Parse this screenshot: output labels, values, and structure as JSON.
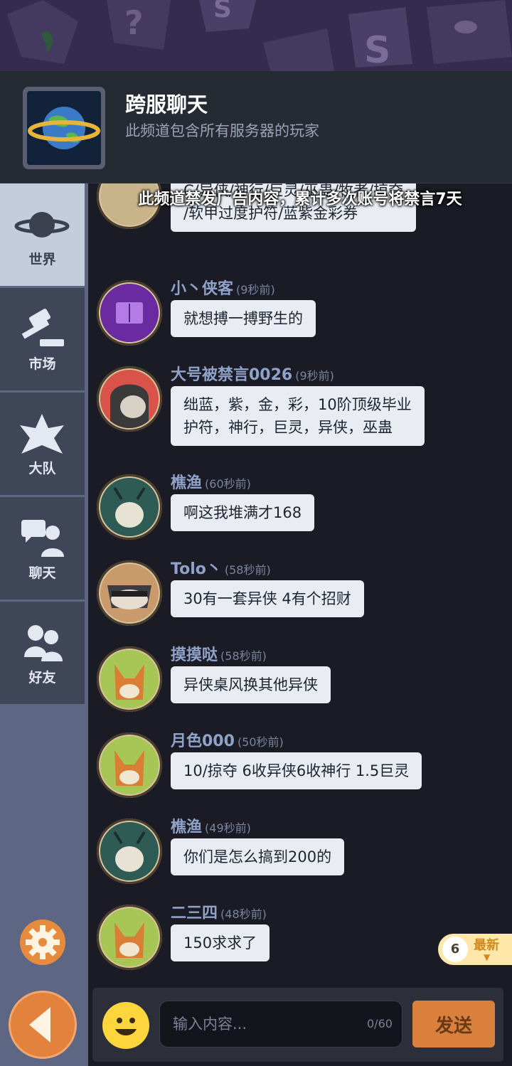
{
  "channel": {
    "title": "跨服聊天",
    "subtitle": "此频道包含所有服务器的玩家",
    "rules_notice": "此频道禁发广告内容，累计多次账号将禁言7天"
  },
  "sidebar": {
    "items": [
      {
        "label": "世界",
        "icon": "planet-icon",
        "active": true
      },
      {
        "label": "市场",
        "icon": "gavel-icon",
        "active": false
      },
      {
        "label": "大队",
        "icon": "guild-crest-icon",
        "active": false
      },
      {
        "label": "聊天",
        "icon": "chat-people-icon",
        "active": false
      },
      {
        "label": "好友",
        "icon": "friends-icon",
        "active": false
      }
    ],
    "settings_icon": "gear-icon",
    "back_icon": "back-arrow-icon"
  },
  "messages": [
    {
      "name": "",
      "time": "",
      "text_lines": [
        "C/异侠/神行/巨灵/巫蛊/牧者/掠夺",
        "/软甲过度护符/蓝紫金彩券"
      ],
      "avatar": "partial-avatar"
    },
    {
      "name": "小丶侠客",
      "time": "(9秒前)",
      "text_lines": [
        "就想搏一搏野生的"
      ],
      "avatar": "purple-spellbook-avatar"
    },
    {
      "name": "大号被禁言0026",
      "time": "(9秒前)",
      "text_lines": [
        "绌蓝，紫，金，彩，10阶顶级毕业",
        "护符，神行，巨灵，异侠，巫蛊"
      ],
      "avatar": "hooded-cat-avatar"
    },
    {
      "name": "樵渔",
      "time": "(60秒前)",
      "text_lines": [
        "啊这我堆满才168"
      ],
      "avatar": "antler-spirit-avatar"
    },
    {
      "name": "Tolo丶",
      "time": "(58秒前)",
      "text_lines": [
        "30有一套异侠 4有个招财"
      ],
      "avatar": "raccoon-avatar"
    },
    {
      "name": "摸摸哒",
      "time": "(58秒前)",
      "text_lines": [
        "异侠桌风换其他异侠"
      ],
      "avatar": "fox-avatar"
    },
    {
      "name": "月色000",
      "time": "(50秒前)",
      "text_lines": [
        "10/掠夺 6收异侠6收神行 1.5巨灵"
      ],
      "avatar": "fox-avatar"
    },
    {
      "name": "樵渔",
      "time": "(49秒前)",
      "text_lines": [
        "你们是怎么搞到200的"
      ],
      "avatar": "antler-spirit-avatar"
    },
    {
      "name": "二三四",
      "time": "(48秒前)",
      "text_lines": [
        "150求求了"
      ],
      "avatar": "fox-avatar"
    }
  ],
  "new_messages": {
    "count": "6",
    "label": "最新"
  },
  "input": {
    "placeholder": "输入内容...",
    "counter": "0/60",
    "send_label": "发送",
    "emoji_icon": "smiley-icon"
  },
  "colors": {
    "accent": "#e3823d",
    "name": "#8fa2c9",
    "bubble": "#e9edf3",
    "sidebar_active": "#c4cddc"
  }
}
